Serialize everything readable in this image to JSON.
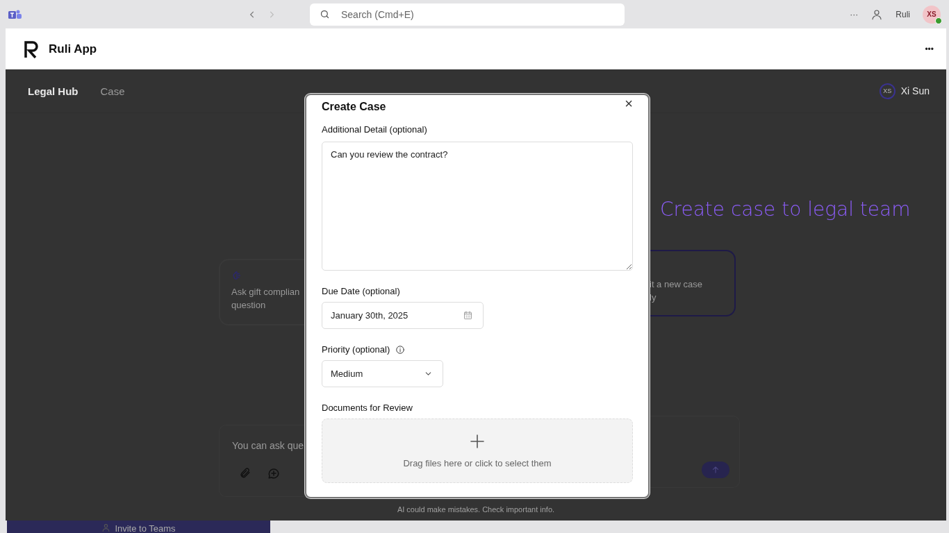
{
  "top_bar": {
    "search": {
      "placeholder": "Search (Cmd+E)"
    },
    "more": "···",
    "user_name": "Ruli",
    "avatar": "XS",
    "online": true
  },
  "app_bar": {
    "title": "Ruli App",
    "more": "•••"
  },
  "nav": {
    "tabs": [
      {
        "label": "Legal Hub",
        "selected": true
      },
      {
        "label": "Case",
        "selected": false
      }
    ],
    "user": {
      "initials": "XS",
      "name": "Xi Sun"
    }
  },
  "cards": [
    {
      "lines": [
        "Ask gift complian",
        "question"
      ],
      "highlighted": false
    },
    {
      "lines": [
        "it a new case",
        "ly"
      ],
      "highlighted": true
    }
  ],
  "chat": {
    "placeholder": "You can ask que"
  },
  "disclaimer": "AI could make mistakes. Check important info.",
  "annotation": "Create case to legal team",
  "invite_button": "Invite to Teams",
  "modal": {
    "title": "Create Case",
    "close": "×",
    "detail": {
      "label": "Additional Detail (optional)",
      "value": "Can you review the contract?"
    },
    "due_date": {
      "label": "Due Date (optional)",
      "value": "January 30th, 2025"
    },
    "priority": {
      "label": "Priority (optional)",
      "value": "Medium"
    },
    "documents": {
      "label": "Documents for Review",
      "hint": "Drag files here or click to select them"
    }
  }
}
